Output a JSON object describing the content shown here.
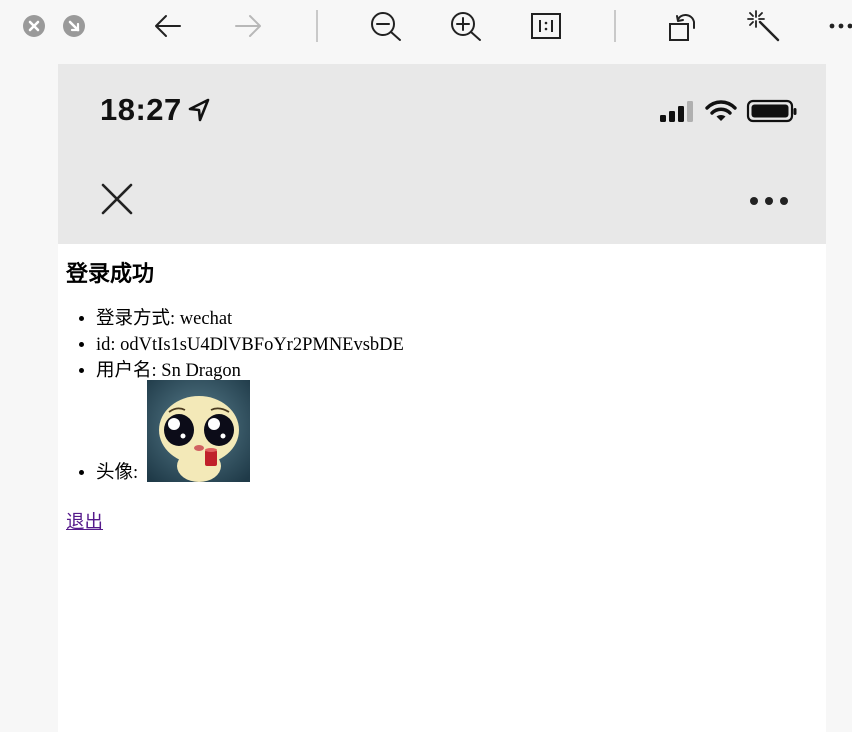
{
  "status_bar": {
    "time": "18:27"
  },
  "page": {
    "heading": "登录成功",
    "info": [
      {
        "label": "登录方式",
        "sep": ": ",
        "value": "wechat"
      },
      {
        "label": "id",
        "sep": ": ",
        "value": "odVtIs1sU4DlVBFoYr2PMNEvsbDE"
      },
      {
        "label": "用户名",
        "sep": ": ",
        "value": "Sn Dragon"
      }
    ],
    "avatar_label": "头像",
    "avatar_sep": ": ",
    "logout_link": "退出"
  },
  "icons": {
    "toolbar": [
      "close-window-icon",
      "minimize-icon",
      "back-arrow-icon",
      "forward-arrow-icon",
      "zoom-out-icon",
      "zoom-in-icon",
      "actual-size-icon",
      "rotate-icon",
      "magic-wand-icon",
      "more-icon"
    ],
    "status": [
      "location-arrow-icon",
      "signal-icon",
      "wifi-icon",
      "battery-icon"
    ],
    "header": [
      "close-icon",
      "more-icon"
    ]
  },
  "colors": {
    "toolbar_bg": "#f7f7f7",
    "header_bg": "#e8e8e8",
    "link_visited": "#551a8b",
    "disabled_icon": "#b8b8b8"
  }
}
